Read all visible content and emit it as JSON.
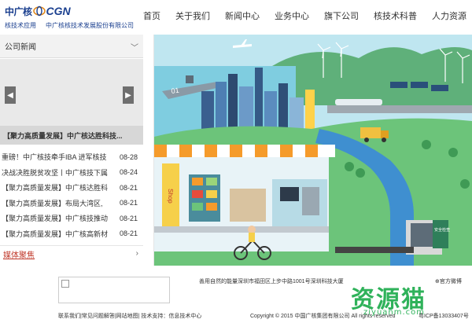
{
  "header": {
    "logo_cn": "中广核",
    "logo_en": "CGN",
    "tagline_left": "核技术应用",
    "tagline_right": "中广核核技术发展股份有限公司",
    "nav": [
      "首页",
      "关于我们",
      "新闻中心",
      "业务中心",
      "旗下公司",
      "核技术科普",
      "人力资源"
    ]
  },
  "sidebar": {
    "title": "公司新闻",
    "slide_caption": "【聚力高质量发展】中广核达胜科技...",
    "news": [
      {
        "title": "重磅！中广核技牵手IBA 进军核技",
        "date": "08-28"
      },
      {
        "title": "决战决胜脱贫攻坚丨中广核技下属",
        "date": "08-24"
      },
      {
        "title": "【聚力高质量发展】中广核达胜科",
        "date": "08-21"
      },
      {
        "title": "【聚力高质量发展】布局大湾区,",
        "date": "08-21"
      },
      {
        "title": "【聚力高质量发展】中广核技推动",
        "date": "08-21"
      },
      {
        "title": "【聚力高质量发展】中广核高新材",
        "date": "08-21"
      }
    ],
    "media_label": "媒体聚焦"
  },
  "hero": {
    "ship_number": "01",
    "shop_sign": "Shop",
    "security_sign": "安全检查"
  },
  "footer": {
    "address": "善用自然的能量深圳市福田区上步中路1001号深圳科技大厦",
    "weibo": "官方微博",
    "links": "联系我们|常见问题解答|网站地图| 技术支持：信息技术中心",
    "copyright": "Copyright © 2015 中国广核集团有限公司 All rights reserved",
    "icp": "粤ICP备13033407号"
  },
  "watermark": {
    "cn": "资源猫",
    "en": "ziyuanm.com"
  },
  "colors": {
    "brand_blue": "#1a3f8f",
    "watermark_green": "#2fb25a",
    "media_red": "#c0392b"
  }
}
